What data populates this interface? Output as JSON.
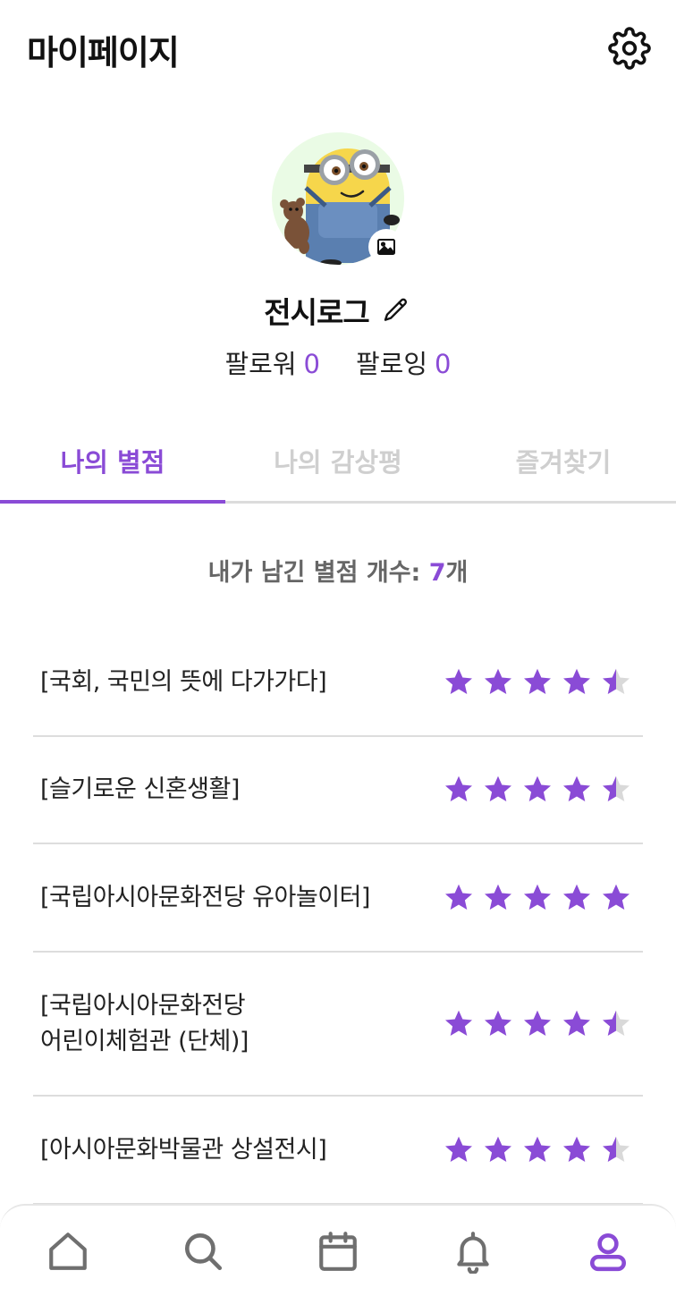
{
  "header": {
    "title": "마이페이지"
  },
  "profile": {
    "nickname": "전시로그",
    "followers_label": "팔로워",
    "followers_count": "0",
    "following_label": "팔로잉",
    "following_count": "0"
  },
  "tabs": [
    {
      "label": "나의 별점",
      "active": true
    },
    {
      "label": "나의 감상평",
      "active": false
    },
    {
      "label": "즐겨찾기",
      "active": false
    }
  ],
  "ratings_summary": {
    "label": "내가 남긴 별점 개수: ",
    "count": "7",
    "unit": "개"
  },
  "ratings": [
    {
      "title": "[국회, 국민의 뜻에 다가가다]",
      "stars": 4.5
    },
    {
      "title": "[슬기로운 신혼생활]",
      "stars": 4.5
    },
    {
      "title": "[국립아시아문화전당 유아놀이터]",
      "stars": 5
    },
    {
      "title": "[국립아시아문화전당\n어린이체험관 (단체)]",
      "stars": 4.5
    },
    {
      "title": "[아시아문화박물관 상설전시]",
      "stars": 4.5
    }
  ],
  "bottom_nav": [
    {
      "icon": "home-icon",
      "active": false
    },
    {
      "icon": "search-icon",
      "active": false
    },
    {
      "icon": "calendar-icon",
      "active": false
    },
    {
      "icon": "bell-icon",
      "active": false
    },
    {
      "icon": "user-icon",
      "active": true
    }
  ],
  "colors": {
    "accent": "#8a4bd6",
    "star_empty": "#d9d9d9",
    "nav_inactive": "#6f6f6f"
  }
}
